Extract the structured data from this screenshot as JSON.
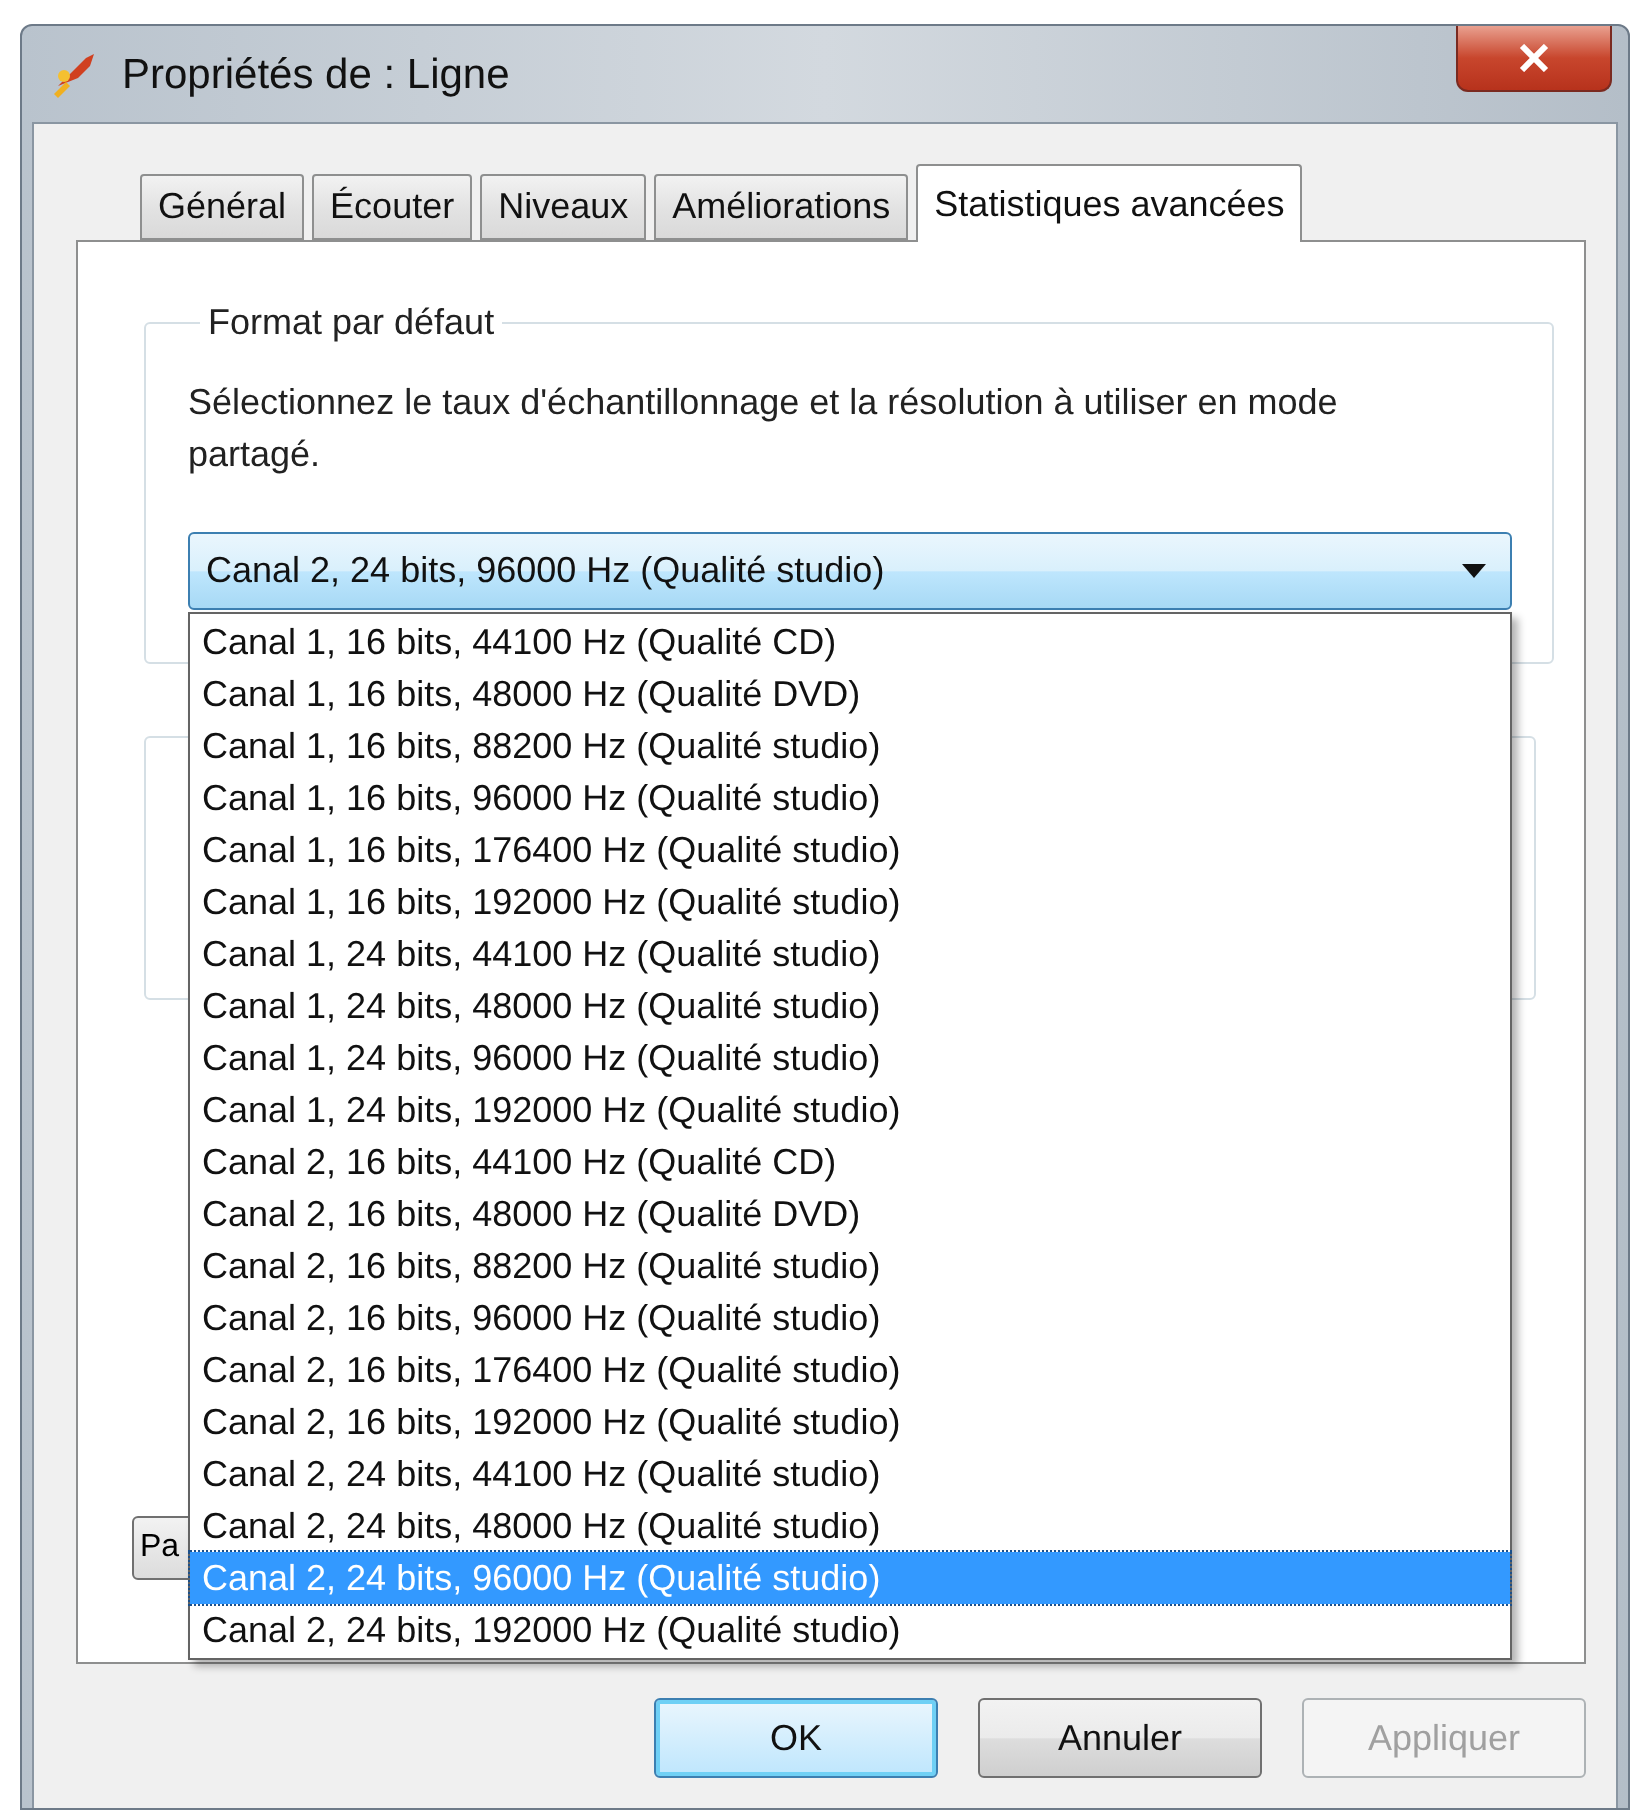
{
  "window": {
    "title": "Propriétés de : Ligne"
  },
  "tabs": [
    {
      "label": "Général",
      "selected": false
    },
    {
      "label": "Écouter",
      "selected": false
    },
    {
      "label": "Niveaux",
      "selected": false
    },
    {
      "label": "Améliorations",
      "selected": false
    },
    {
      "label": "Statistiques avancées",
      "selected": true
    }
  ],
  "default_format": {
    "label": "Format par défaut",
    "description": "Sélectionnez le taux d'échantillonnage et la résolution à utiliser en mode partagé.",
    "value": "Canal 2, 24 bits, 96000 Hz (Qualité studio)",
    "expanded": true,
    "options": [
      {
        "label": "Canal 1, 16 bits, 44100 Hz (Qualité CD)",
        "selected": false
      },
      {
        "label": "Canal 1, 16 bits, 48000 Hz (Qualité DVD)",
        "selected": false
      },
      {
        "label": "Canal 1, 16 bits, 88200 Hz (Qualité studio)",
        "selected": false
      },
      {
        "label": "Canal 1, 16 bits, 96000 Hz (Qualité studio)",
        "selected": false
      },
      {
        "label": "Canal 1, 16 bits, 176400 Hz (Qualité studio)",
        "selected": false
      },
      {
        "label": "Canal 1, 16 bits, 192000 Hz (Qualité studio)",
        "selected": false
      },
      {
        "label": "Canal 1, 24 bits, 44100 Hz (Qualité studio)",
        "selected": false
      },
      {
        "label": "Canal 1, 24 bits, 48000 Hz (Qualité studio)",
        "selected": false
      },
      {
        "label": "Canal 1, 24 bits, 96000 Hz (Qualité studio)",
        "selected": false
      },
      {
        "label": "Canal 1, 24 bits, 192000 Hz (Qualité studio)",
        "selected": false
      },
      {
        "label": "Canal 2, 16 bits, 44100 Hz (Qualité CD)",
        "selected": false
      },
      {
        "label": "Canal 2, 16 bits, 48000 Hz (Qualité DVD)",
        "selected": false
      },
      {
        "label": "Canal 2, 16 bits, 88200 Hz (Qualité studio)",
        "selected": false
      },
      {
        "label": "Canal 2, 16 bits, 96000 Hz (Qualité studio)",
        "selected": false
      },
      {
        "label": "Canal 2, 16 bits, 176400 Hz (Qualité studio)",
        "selected": false
      },
      {
        "label": "Canal 2, 16 bits, 192000 Hz (Qualité studio)",
        "selected": false
      },
      {
        "label": "Canal 2, 24 bits, 44100 Hz (Qualité studio)",
        "selected": false
      },
      {
        "label": "Canal 2, 24 bits, 48000 Hz (Qualité studio)",
        "selected": false
      },
      {
        "label": "Canal 2, 24 bits, 96000 Hz (Qualité studio)",
        "selected": true
      },
      {
        "label": "Canal 2, 24 bits, 192000 Hz (Qualité studio)",
        "selected": false
      }
    ]
  },
  "panel_button": {
    "label": "Pa"
  },
  "buttons": [
    {
      "label": "OK",
      "kind": "default",
      "disabled": false
    },
    {
      "label": "Annuler",
      "kind": "normal",
      "disabled": false
    },
    {
      "label": "Appliquer",
      "kind": "normal",
      "disabled": true
    }
  ]
}
